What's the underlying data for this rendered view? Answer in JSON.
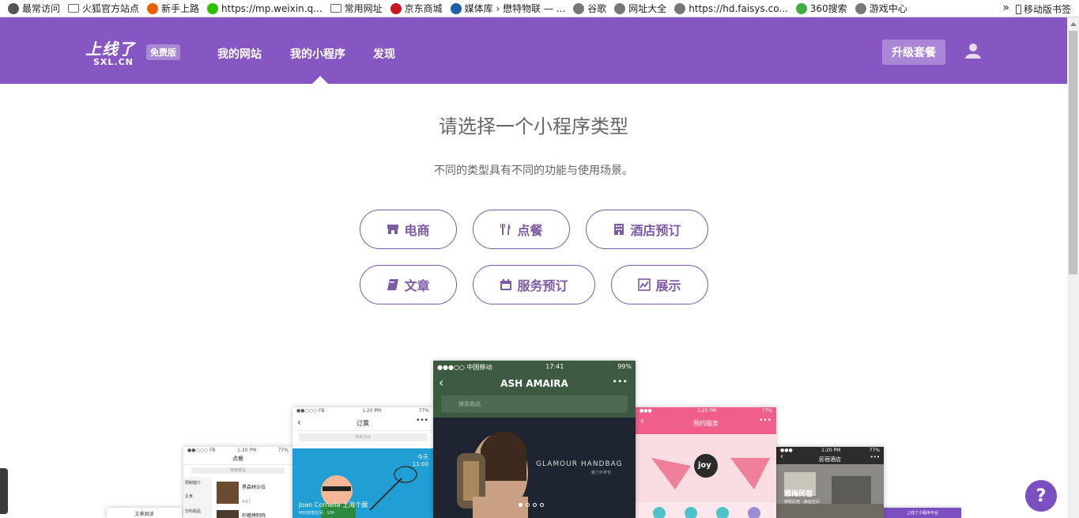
{
  "bookmarks": [
    {
      "label": "最常访问",
      "icon": "gear-icon",
      "color": "#555555"
    },
    {
      "label": "火狐官方站点",
      "icon": "folder-icon",
      "color": "#666666"
    },
    {
      "label": "新手上路",
      "icon": "firefox-icon",
      "color": "#e66000"
    },
    {
      "label": "https://mp.weixin.q...",
      "icon": "wechat-icon",
      "color": "#2dc100"
    },
    {
      "label": "常用网址",
      "icon": "folder-icon",
      "color": "#666666"
    },
    {
      "label": "京东商城",
      "icon": "jd-icon",
      "color": "#c81623"
    },
    {
      "label": "媒体库 › 懋特物联 — ...",
      "icon": "media-icon",
      "color": "#1f5fa8"
    },
    {
      "label": "谷歌",
      "icon": "globe-icon",
      "color": "#777777"
    },
    {
      "label": "网址大全",
      "icon": "globe-icon",
      "color": "#777777"
    },
    {
      "label": "https://hd.faisys.co...",
      "icon": "globe-icon",
      "color": "#777777"
    },
    {
      "label": "360搜索",
      "icon": "360-icon",
      "color": "#3cb043"
    },
    {
      "label": "游戏中心",
      "icon": "globe-icon",
      "color": "#777777"
    }
  ],
  "bookmarks_more": "»",
  "mobile_bookmarks": "移动版书签",
  "header": {
    "logo_text": "上线了",
    "logo_sub": "SXL.CN",
    "free_badge": "免费版",
    "nav": [
      "我的网站",
      "我的小程序",
      "发现"
    ],
    "upgrade": "升级套餐",
    "accent": "#8656c2"
  },
  "main": {
    "title": "请选择一个小程序类型",
    "subtitle": "不同的类型具有不同的功能与使用场景。",
    "types": [
      {
        "label": "电商",
        "icon": "shop-icon"
      },
      {
        "label": "点餐",
        "icon": "utensils-icon"
      },
      {
        "label": "酒店预订",
        "icon": "building-icon"
      },
      {
        "label": "文章",
        "icon": "book-icon"
      },
      {
        "label": "服务预订",
        "icon": "calendar-icon"
      },
      {
        "label": "展示",
        "icon": "chart-icon"
      }
    ]
  },
  "phones": {
    "center": {
      "carrier": "●●●○○ 中国移动",
      "time": "17:41",
      "battery": "99%",
      "title": "ASH AMAIRA",
      "search": "搜索商品",
      "banner_text": "GLAMOUR HANDBAG",
      "banner_sub": "魅力手拿包"
    },
    "ticket": {
      "status_left": "●●○○○ FB",
      "time": "1:20 PM",
      "battery": "77%",
      "title": "订票",
      "search": "搜索活动",
      "date": "今天",
      "clock": "11:00",
      "caption": "Joan Cornella 上海个展",
      "caption2": "M50创意空间 · 100"
    },
    "order": {
      "status_left": "●●○○○ FB",
      "time": "1:20 PM",
      "battery": "77%",
      "title": "点餐",
      "search": "搜索菜品",
      "cat1": "限制健介",
      "cat2": "主食",
      "cat3": "饮料甜品",
      "dish1": "黑森林沙拉",
      "price1": "¥47",
      "dish2": "柠檬烤制鸡"
    },
    "article": {
      "title": "文章阅读"
    },
    "service": {
      "time": "1:20 PM",
      "battery": "77%",
      "title": "预约服务",
      "joy": "joy"
    },
    "hotel": {
      "time": "1:20 PM",
      "battery": "77%",
      "title": "民宿酒店",
      "caption": "雅梅民宿",
      "caption2": "精致民宿 · 静谧空间"
    },
    "far": {
      "title": "上线了小程序平台"
    }
  },
  "help": "?"
}
